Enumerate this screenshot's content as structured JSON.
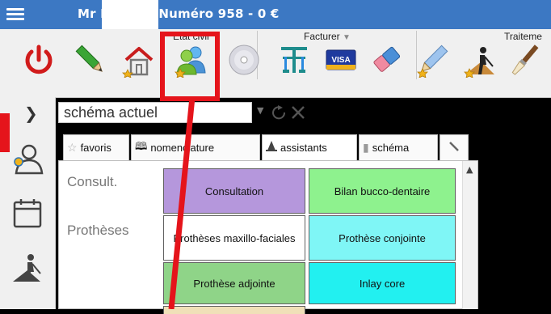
{
  "titlebar": {
    "title": "Mr    Daniel  - Numéro 958 - 0 €"
  },
  "toolbar": {
    "groups": [
      {
        "label": "Etat civil"
      },
      {
        "label": "Facturer"
      },
      {
        "label": "Traiteme"
      }
    ],
    "icons": [
      "power-icon",
      "pencil-icon",
      "home-icon",
      "users-icon",
      "cd-icon",
      "tree-icon",
      "visa-card-icon",
      "eraser-icon",
      "pencil-star-icon",
      "worker-icon",
      "brush-icon"
    ]
  },
  "sidebar": {
    "icons": [
      "user-profile-icon",
      "calendar-icon",
      "worker-icon"
    ]
  },
  "schema": {
    "value": "schéma actuel"
  },
  "tabs": [
    {
      "label": "favoris"
    },
    {
      "label": "nomenclature"
    },
    {
      "label": "assistants"
    },
    {
      "label": "schéma"
    }
  ],
  "categories": [
    {
      "label": "Consult."
    },
    {
      "label": "Prothèses"
    }
  ],
  "buttons": [
    {
      "label": "Consultation",
      "color": "#b597dc"
    },
    {
      "label": "Bilan bucco-dentaire",
      "color": "#8ef28e"
    },
    {
      "label": "Prothèses maxillo-faciales",
      "color": "#ffffff"
    },
    {
      "label": "Prothèse conjointe",
      "color": "#7ff6f6"
    },
    {
      "label": "Prothèse adjointe",
      "color": "#8fd488"
    },
    {
      "label": "Inlay core",
      "color": "#22f0f0"
    }
  ],
  "colors": {
    "titlebar": "#3c78c3",
    "highlight": "#e5141b",
    "toolbar": "#f0f0f0"
  }
}
